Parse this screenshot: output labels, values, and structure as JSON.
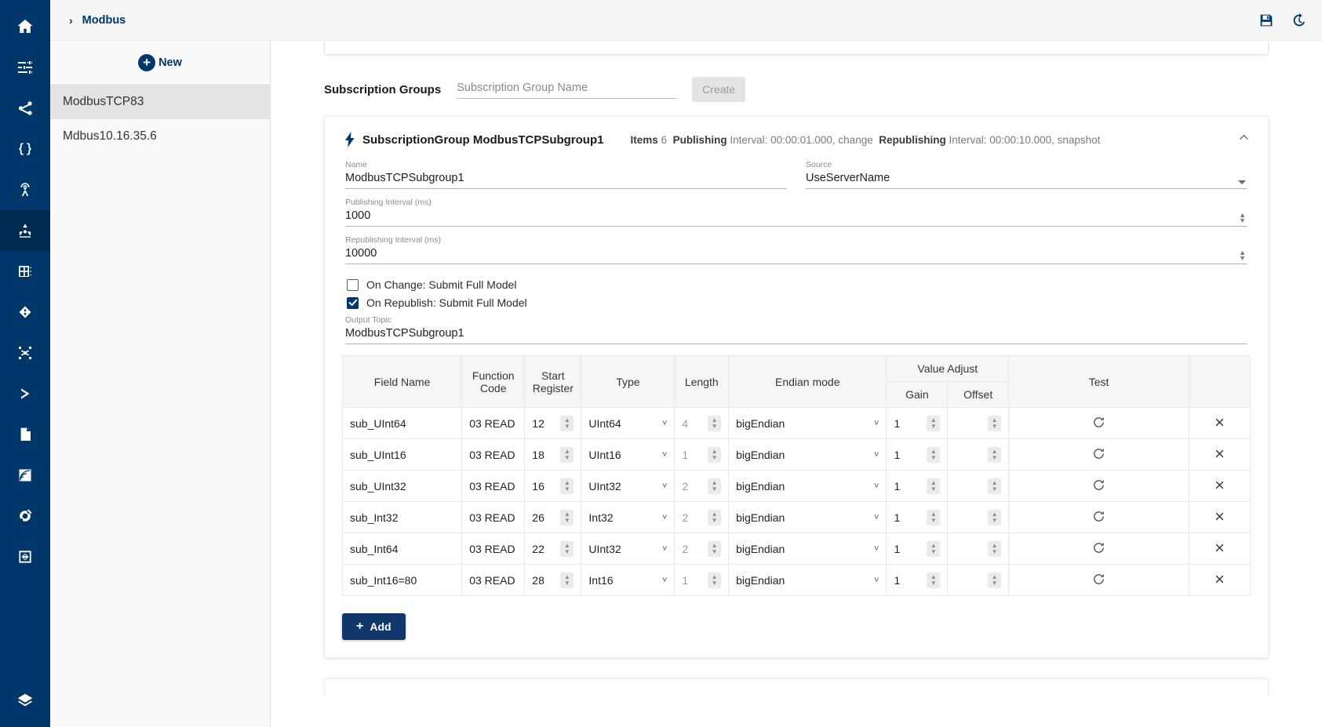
{
  "rail": {
    "items": [
      {
        "name": "home-icon",
        "label": "Home",
        "active": false
      },
      {
        "name": "sliders-icon",
        "label": "Settings",
        "active": false
      },
      {
        "name": "share-icon",
        "label": "Share",
        "active": false
      },
      {
        "name": "braces-icon",
        "label": "JSON",
        "active": false
      },
      {
        "name": "antenna-icon",
        "label": "Broadcast",
        "active": false
      },
      {
        "name": "modbus-icon",
        "label": "Modbus",
        "active": true
      },
      {
        "name": "chip-icon",
        "label": "Device",
        "active": false
      },
      {
        "name": "diamond-icon",
        "label": "Node",
        "active": false
      },
      {
        "name": "scatter-nodes-icon",
        "label": "Topology",
        "active": false
      },
      {
        "name": "chevron-right-icon",
        "label": "Console",
        "active": false
      },
      {
        "name": "file-icon",
        "label": "Files",
        "active": false
      },
      {
        "name": "wave-icon",
        "label": "Signals",
        "active": false
      },
      {
        "name": "target-icon",
        "label": "Monitor",
        "active": false
      },
      {
        "name": "boxed-diamond-icon",
        "label": "Package",
        "active": false
      },
      {
        "name": "layers-icon",
        "label": "Layers",
        "active": false
      }
    ]
  },
  "topbar": {
    "breadcrumb_chevron": "›",
    "breadcrumb": "Modbus",
    "save_icon": "save-icon",
    "restore_icon": "restore-icon"
  },
  "listpanel": {
    "new_label": "New",
    "new_plus": "+",
    "items": [
      {
        "label": "ModbusTCP83",
        "selected": true
      },
      {
        "label": "Mdbus10.16.35.6",
        "selected": false
      }
    ]
  },
  "subscription": {
    "title": "Subscription Groups",
    "name_placeholder": "Subscription Group Name",
    "name_value": "",
    "create_label": "Create"
  },
  "group": {
    "title_prefix": "SubscriptionGroup",
    "title_name": "ModbusTCPSubgroup1",
    "title": "SubscriptionGroup ModbusTCPSubgroup1",
    "meta_items_label": "Items",
    "meta_items_value": "6",
    "meta_publishing_label": "Publishing",
    "meta_publishing_value": "Interval: 00:00:01.000, change",
    "meta_republishing_label": "Republishing",
    "meta_republishing_value": "Interval: 00:00:10.000, snapshot",
    "fields": {
      "name_label": "Name",
      "name_value": "ModbusTCPSubgroup1",
      "source_label": "Source",
      "source_value": "UseServerName",
      "publishing_label": "Publishing Interval (ms)",
      "publishing_value": "1000",
      "republishing_label": "Republishing Interval (ms)",
      "republishing_value": "10000",
      "output_topic_label": "Output Topic",
      "output_topic_value": "ModbusTCPSubgroup1"
    },
    "checks": {
      "on_change_label": "On Change: Submit Full Model",
      "on_change_checked": false,
      "on_republish_label": "On Republish: Submit Full Model",
      "on_republish_checked": true
    }
  },
  "table": {
    "headers": {
      "field_name": "Field Name",
      "function_code": "Function Code",
      "start_register": "Start Register",
      "type": "Type",
      "length": "Length",
      "endian_mode": "Endian mode",
      "value_adjust": "Value Adjust",
      "gain": "Gain",
      "offset": "Offset",
      "test": "Test"
    },
    "rows": [
      {
        "field_name": "sub_UInt64",
        "function_code": "03 READ",
        "start_register": "12",
        "type": "UInt64",
        "length": "4",
        "endian_mode": "bigEndian",
        "gain": "1",
        "offset": "",
        "test": ""
      },
      {
        "field_name": "sub_UInt16",
        "function_code": "03 READ",
        "start_register": "18",
        "type": "UInt16",
        "length": "1",
        "endian_mode": "bigEndian",
        "gain": "1",
        "offset": "",
        "test": ""
      },
      {
        "field_name": "sub_UInt32",
        "function_code": "03 READ",
        "start_register": "16",
        "type": "UInt32",
        "length": "2",
        "endian_mode": "bigEndian",
        "gain": "1",
        "offset": "",
        "test": ""
      },
      {
        "field_name": "sub_Int32",
        "function_code": "03 READ",
        "start_register": "26",
        "type": "Int32",
        "length": "2",
        "endian_mode": "bigEndian",
        "gain": "1",
        "offset": "",
        "test": ""
      },
      {
        "field_name": "sub_Int64",
        "function_code": "03 READ",
        "start_register": "22",
        "type": "UInt32",
        "length": "2",
        "endian_mode": "bigEndian",
        "gain": "1",
        "offset": "",
        "test": ""
      },
      {
        "field_name": "sub_Int16=80",
        "function_code": "03 READ",
        "start_register": "28",
        "type": "Int16",
        "length": "1",
        "endian_mode": "bigEndian",
        "gain": "1",
        "offset": "",
        "test": ""
      }
    ],
    "add_label": "Add",
    "add_plus": "+"
  },
  "colors": {
    "brand_navy": "#00376b",
    "rail_active": "#002a52",
    "add_button": "#12386b",
    "panel_bg": "#fafafa",
    "selected_row": "#e3e3e3"
  }
}
